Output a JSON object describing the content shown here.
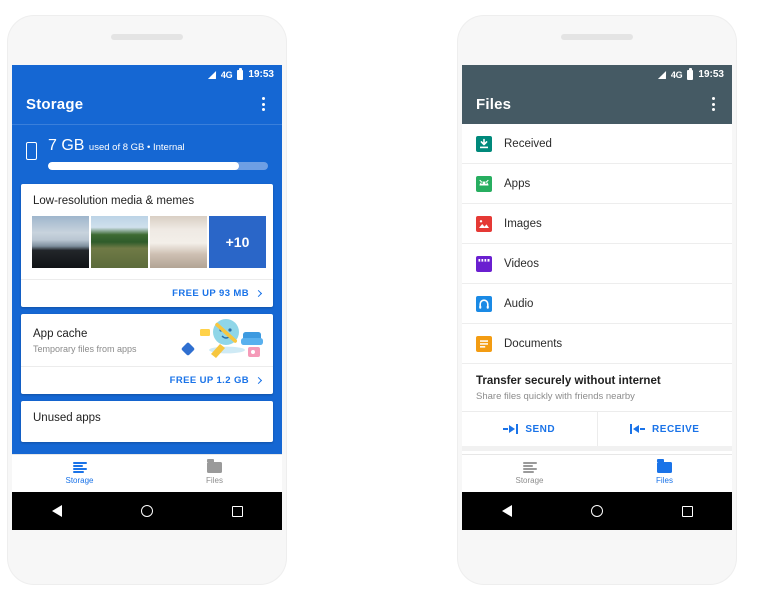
{
  "statusbar": {
    "network": "4G",
    "time": "19:53",
    "signal_icon": "signal-triangle-icon",
    "battery_icon": "battery-icon"
  },
  "left_phone": {
    "app": "Storage",
    "accent": "#1567d3",
    "appbar": {
      "title": "Storage",
      "overflow_icon": "kebab-menu-icon"
    },
    "summary": {
      "device_icon": "phone-icon",
      "used": "7 GB",
      "detail": "used of 8 GB • Internal",
      "progress_percent": 87
    },
    "cards": [
      {
        "title": "Low-resolution media & memes",
        "thumbs": [
          "beach-photo",
          "crowd-photo",
          "cat-photo"
        ],
        "overflow_badge": "+10",
        "action": "FREE UP 93 MB",
        "action_icon": "chevron-right-icon"
      },
      {
        "title": "App cache",
        "subtitle": "Temporary files from apps",
        "illustration": "broom-cleaning-illustration",
        "action": "FREE UP 1.2 GB",
        "action_icon": "chevron-right-icon"
      },
      {
        "title": "Unused apps"
      }
    ],
    "tabs": [
      {
        "label": "Storage",
        "icon": "storage-list-icon",
        "active": true
      },
      {
        "label": "Files",
        "icon": "folder-icon",
        "active": false
      }
    ]
  },
  "right_phone": {
    "app": "Files",
    "accent": "#455a64",
    "appbar": {
      "title": "Files",
      "overflow_icon": "kebab-menu-icon"
    },
    "list": [
      {
        "label": "Received",
        "icon": "received-download-icon",
        "color": "#00897b"
      },
      {
        "label": "Apps",
        "icon": "android-apps-icon",
        "color": "#27ae60"
      },
      {
        "label": "Images",
        "icon": "image-icon",
        "color": "#e53935"
      },
      {
        "label": "Videos",
        "icon": "video-clapper-icon",
        "color": "#6a1fd0"
      },
      {
        "label": "Audio",
        "icon": "audio-headphone-icon",
        "color": "#1a8ae5"
      },
      {
        "label": "Documents",
        "icon": "document-icon",
        "color": "#f39c12"
      }
    ],
    "transfer": {
      "title": "Transfer securely without internet",
      "subtitle": "Share files quickly with friends nearby",
      "send_label": "SEND",
      "send_icon": "arrow-send-icon",
      "receive_label": "RECEIVE",
      "receive_icon": "arrow-receive-icon"
    },
    "tabs": [
      {
        "label": "Storage",
        "icon": "storage-list-icon",
        "active": false
      },
      {
        "label": "Files",
        "icon": "folder-icon",
        "active": true
      }
    ]
  },
  "navbar": {
    "back_icon": "nav-back-icon",
    "home_icon": "nav-home-icon",
    "recents_icon": "nav-recents-icon"
  }
}
